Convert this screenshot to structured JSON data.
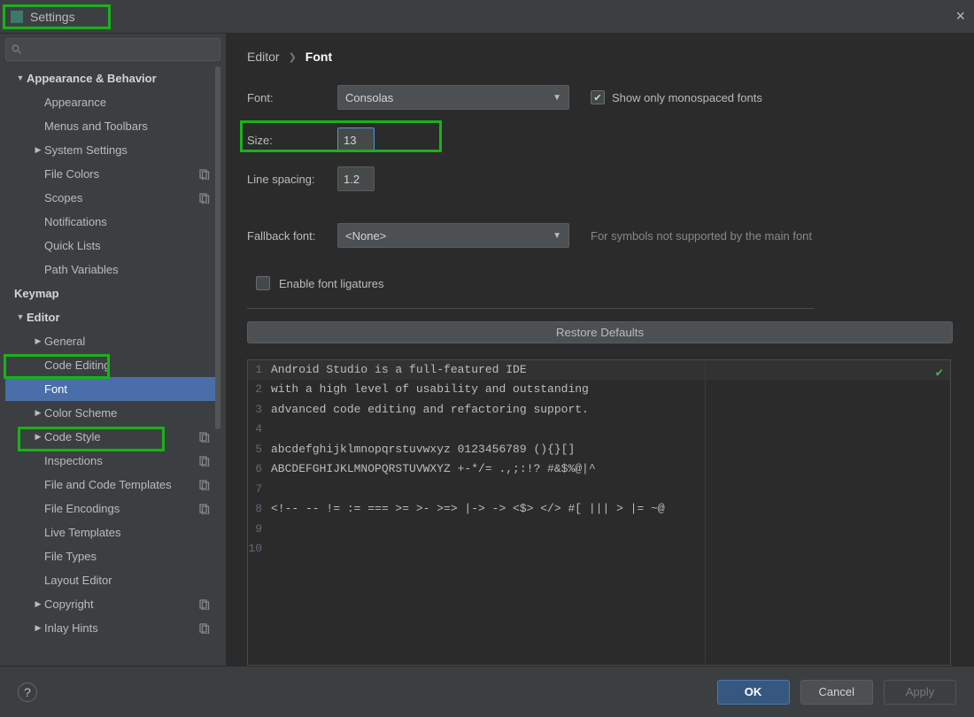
{
  "window": {
    "title": "Settings"
  },
  "sidebar": {
    "items": [
      {
        "label": "Appearance & Behavior",
        "bold": true,
        "depth": 0,
        "arrow": "down"
      },
      {
        "label": "Appearance",
        "depth": 1
      },
      {
        "label": "Menus and Toolbars",
        "depth": 1
      },
      {
        "label": "System Settings",
        "depth": 1,
        "arrow": "right"
      },
      {
        "label": "File Colors",
        "depth": 1,
        "scheme": true
      },
      {
        "label": "Scopes",
        "depth": 1,
        "scheme": true
      },
      {
        "label": "Notifications",
        "depth": 1
      },
      {
        "label": "Quick Lists",
        "depth": 1
      },
      {
        "label": "Path Variables",
        "depth": 1
      },
      {
        "label": "Keymap",
        "bold": true,
        "depth": 0
      },
      {
        "label": "Editor",
        "bold": true,
        "depth": 0,
        "arrow": "down"
      },
      {
        "label": "General",
        "depth": 1,
        "arrow": "right"
      },
      {
        "label": "Code Editing",
        "depth": 1
      },
      {
        "label": "Font",
        "depth": 1,
        "selected": true
      },
      {
        "label": "Color Scheme",
        "depth": 1,
        "arrow": "right"
      },
      {
        "label": "Code Style",
        "depth": 1,
        "arrow": "right",
        "scheme": true
      },
      {
        "label": "Inspections",
        "depth": 1,
        "scheme": true
      },
      {
        "label": "File and Code Templates",
        "depth": 1,
        "scheme": true
      },
      {
        "label": "File Encodings",
        "depth": 1,
        "scheme": true
      },
      {
        "label": "Live Templates",
        "depth": 1
      },
      {
        "label": "File Types",
        "depth": 1
      },
      {
        "label": "Layout Editor",
        "depth": 1
      },
      {
        "label": "Copyright",
        "depth": 1,
        "arrow": "right",
        "scheme": true
      },
      {
        "label": "Inlay Hints",
        "depth": 1,
        "arrow": "right",
        "scheme": true
      }
    ]
  },
  "breadcrumb": {
    "parent": "Editor",
    "current": "Font"
  },
  "form": {
    "font_label": "Font:",
    "font_value": "Consolas",
    "monospace_label": "Show only monospaced fonts",
    "monospace_checked": true,
    "size_label": "Size:",
    "size_value": "13",
    "linespacing_label": "Line spacing:",
    "linespacing_value": "1.2",
    "fallback_label": "Fallback font:",
    "fallback_value": "<None>",
    "fallback_hint": "For symbols not supported by the main font",
    "ligatures_label": "Enable font ligatures",
    "ligatures_checked": false,
    "restore": "Restore Defaults"
  },
  "preview": {
    "lines": [
      "Android Studio is a full-featured IDE",
      "with a high level of usability and outstanding",
      "advanced code editing and refactoring support.",
      "",
      "abcdefghijklmnopqrstuvwxyz 0123456789 (){}[]",
      "ABCDEFGHIJKLMNOPQRSTUVWXYZ +-*/= .,;:!? #&$%@|^",
      "",
      "<!-- -- != := === >= >- >=> |-> -> <$> </> #[ ||| > |= ~@",
      "",
      ""
    ]
  },
  "footer": {
    "ok": "OK",
    "cancel": "Cancel",
    "apply": "Apply"
  }
}
